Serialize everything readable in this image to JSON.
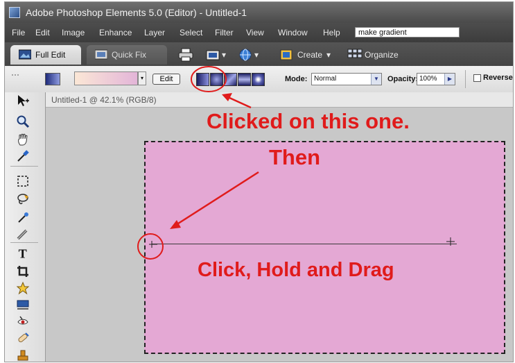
{
  "window": {
    "title": "Adobe Photoshop Elements 5.0 (Editor) - Untitled-1"
  },
  "menubar": {
    "items": [
      "File",
      "Edit",
      "Image",
      "Enhance",
      "Layer",
      "Select",
      "Filter",
      "View",
      "Window",
      "Help"
    ],
    "search_value": "make gradient"
  },
  "modebar": {
    "full_edit_label": "Full Edit",
    "quick_fix_label": "Quick Fix",
    "create_label": "Create",
    "organize_label": "Organize"
  },
  "options": {
    "edit_label": "Edit",
    "mode_label": "Mode:",
    "mode_value": "Normal",
    "opacity_label": "Opacity:",
    "opacity_value": "100%",
    "reverse_label": "Reverse"
  },
  "document": {
    "title": "Untitled-1 @ 42.1% (RGB/8)"
  },
  "annotations": {
    "clicked": "Clicked on this one.",
    "then": "Then",
    "drag": "Click, Hold and Drag"
  },
  "colors": {
    "annotation": "#e01b1b",
    "canvas": "#e4a8d4",
    "gradient_start": "#fbe7d6",
    "gradient_end": "#e3b5d8"
  }
}
